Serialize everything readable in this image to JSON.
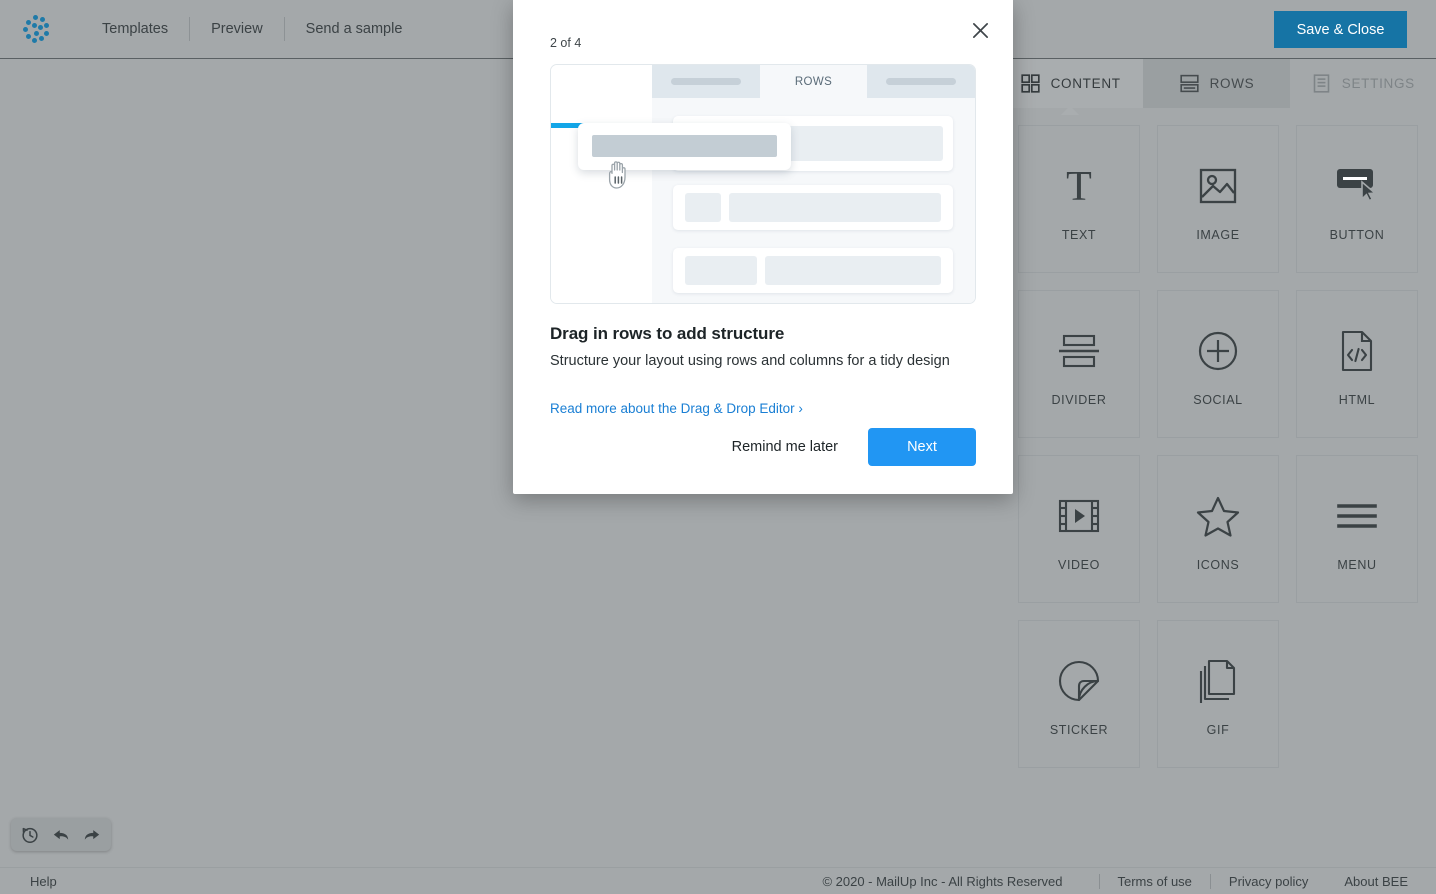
{
  "topbar": {
    "logo_icon": "bee-dots-logo",
    "nav": [
      {
        "label": "Templates"
      },
      {
        "label": "Preview"
      },
      {
        "label": "Send a sample"
      }
    ],
    "save_label": "Save & Close"
  },
  "history_toolbar": {
    "items": [
      {
        "icon": "history-clock-icon",
        "name": "history"
      },
      {
        "icon": "undo-arrow-icon",
        "name": "undo"
      },
      {
        "icon": "redo-arrow-icon",
        "name": "redo"
      }
    ]
  },
  "right_panel": {
    "tabs": [
      {
        "label": "CONTENT",
        "icon": "grid-four-squares-icon",
        "state": "active"
      },
      {
        "label": "ROWS",
        "icon": "rows-stack-icon",
        "state": "hover"
      },
      {
        "label": "SETTINGS",
        "icon": "document-lines-icon",
        "state": "inactive"
      }
    ],
    "tiles": [
      {
        "label": "TEXT",
        "icon": "serif-T-icon"
      },
      {
        "label": "IMAGE",
        "icon": "picture-icon"
      },
      {
        "label": "BUTTON",
        "icon": "button-cursor-icon"
      },
      {
        "label": "DIVIDER",
        "icon": "divider-icon"
      },
      {
        "label": "SOCIAL",
        "icon": "plus-circle-icon"
      },
      {
        "label": "HTML",
        "icon": "code-file-icon"
      },
      {
        "label": "VIDEO",
        "icon": "film-play-icon"
      },
      {
        "label": "ICONS",
        "icon": "star-icon"
      },
      {
        "label": "MENU",
        "icon": "hamburger-lines-icon"
      },
      {
        "label": "STICKER",
        "icon": "sticker-peel-icon"
      },
      {
        "label": "GIF",
        "icon": "stacked-pages-icon"
      }
    ]
  },
  "modal": {
    "step": "2 of 4",
    "close_icon": "close-x-icon",
    "illustration": {
      "tab_label": "ROWS",
      "cursor_icon": "grab-hand-icon"
    },
    "heading": "Drag in rows to add structure",
    "body": "Structure your layout using rows and columns for a tidy design",
    "link": "Read more about the Drag & Drop Editor ›",
    "remind_label": "Remind me later",
    "next_label": "Next"
  },
  "footer": {
    "help": "Help",
    "copyright": "© 2020 -  MailUp Inc - All Rights Reserved",
    "links": [
      {
        "label": "Terms of use"
      },
      {
        "label": "Privacy policy"
      },
      {
        "label": "About BEE"
      }
    ]
  },
  "colors": {
    "chrome_gray": "#a4a8aa",
    "save_blue": "#1674a5",
    "next_blue": "#2196f3",
    "link_blue": "#1a7fd4",
    "accent_cyan": "#13a6e8",
    "logo_blue": "#1f7aa8"
  }
}
